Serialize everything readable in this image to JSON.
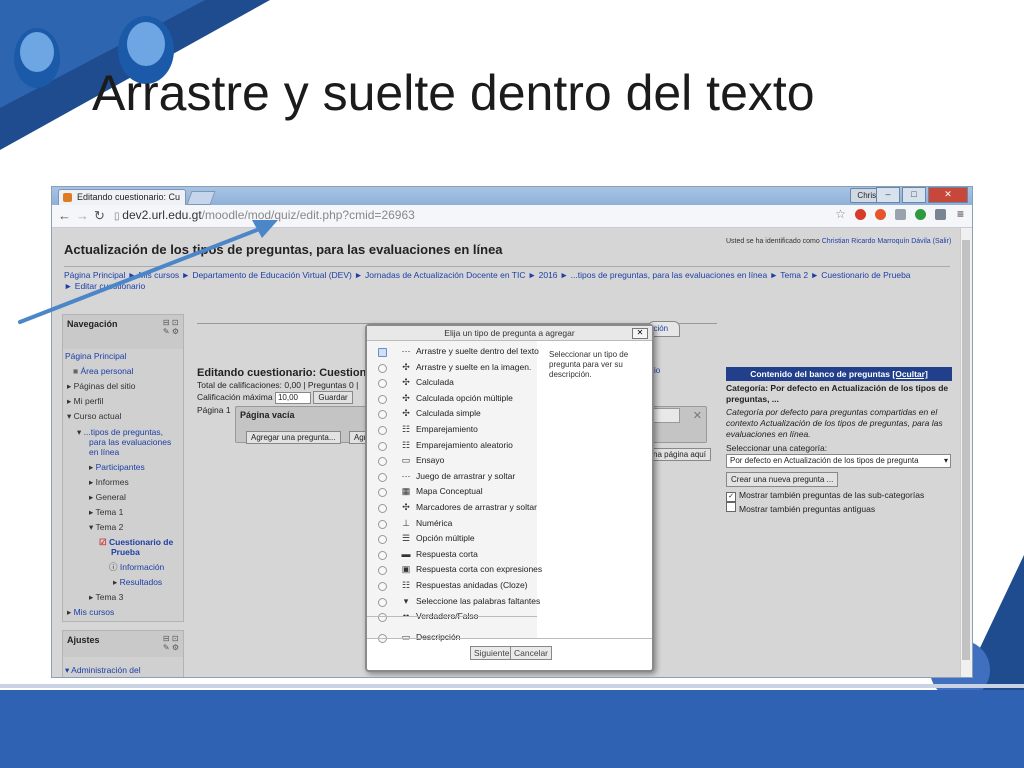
{
  "slide": {
    "title": "Arrastre y suelte dentro del texto"
  },
  "browser": {
    "tab_title": "Editando cuestionario: Cu",
    "user_label": "Christian",
    "url_host": "dev2.url.edu.gt",
    "url_path": "/moodle/mod/quiz/edit.php?cmid=26963"
  },
  "page": {
    "title": "Actualización de los tipos de preguntas, para las evaluaciones en línea",
    "logged_in_prefix": "Usted se ha identificado como",
    "logged_in_user": "Christian Ricardo Marroquín Dávila (Salir)",
    "breadcrumb_line1": "Página Principal ► Mis cursos ► Departamento de Educación Virtual (DEV) ► Jornadas de Actualización Docente en TIC ► 2016 ► ...tipos de preguntas, para las evaluaciones en línea ► Tema 2 ► Cuestionario de Prueba",
    "breadcrumb_line2": "► Editar cuestionario"
  },
  "navigation": {
    "heading": "Navegación",
    "items": [
      "Página Principal",
      "Área personal",
      "Páginas del sitio",
      "Mi perfil",
      "Curso actual",
      "...tipos de preguntas,",
      "para las evaluaciones",
      "en línea",
      "Participantes",
      "Informes",
      "General",
      "Tema 1",
      "Tema 2",
      "Cuestionario de",
      "Prueba",
      "Información",
      "Resultados",
      "Tema 3",
      "Mis cursos"
    ]
  },
  "settings": {
    "heading": "Ajustes",
    "item": "Administración del"
  },
  "quiz": {
    "heading": "Editando cuestionario: Cuestion",
    "total_line": "Total de calificaciones: 0,00 | Preguntas 0 |",
    "max_grade_label": "Calificación máxima",
    "max_grade_value": "10,00",
    "save_button": "Guardar",
    "page_label": "Página 1",
    "empty_page": "Página vacía",
    "add_question_button": "Agregar una pregunta...",
    "add_button_fragment": "Agr",
    "tab_fragment": "ación",
    "link_fragment": "io",
    "new_page_fragment": "na página aquí"
  },
  "bank": {
    "heading": "Contenido del banco de preguntas",
    "hide_link": "[Ocultar]",
    "category_line": "Categoría: Por defecto en Actualización de los tipos de preguntas, ...",
    "category_desc": "Categoría por defecto para preguntas compartidas en el contexto Actualización de los tipos de preguntas, para las evaluaciones en línea.",
    "select_label": "Seleccionar una categoría:",
    "select_value": "Por defecto en Actualización de los tipos de pregunta",
    "create_button": "Crear una nueva pregunta ...",
    "check_subcats": "Mostrar también preguntas de las sub-categorías",
    "check_old": "Mostrar también preguntas antiguas"
  },
  "modal": {
    "title": "Elija un tipo de pregunta a agregar",
    "close": "✕",
    "description": "Seleccionar un tipo de pregunta para ver su descripción.",
    "options": [
      {
        "label": "Arrastre y suelte dentro del texto",
        "icon": "⋯"
      },
      {
        "label": "Arrastre y suelte en la imagen.",
        "icon": "✣"
      },
      {
        "label": "Calculada",
        "icon": "✣"
      },
      {
        "label": "Calculada opción múltiple",
        "icon": "✣"
      },
      {
        "label": "Calculada simple",
        "icon": "✣"
      },
      {
        "label": "Emparejamiento",
        "icon": "☷"
      },
      {
        "label": "Emparejamiento aleatorio",
        "icon": "☷"
      },
      {
        "label": "Ensayo",
        "icon": "▭"
      },
      {
        "label": "Juego de arrastrar y soltar",
        "icon": "⋯"
      },
      {
        "label": "Mapa Conceptual",
        "icon": "▦"
      },
      {
        "label": "Marcadores de arrastrar y soltar",
        "icon": "✣"
      },
      {
        "label": "Numérica",
        "icon": "⊥"
      },
      {
        "label": "Opción múltiple",
        "icon": "☰"
      },
      {
        "label": "Respuesta corta",
        "icon": "▬"
      },
      {
        "label": "Respuesta corta con expresiones",
        "icon": "▣"
      },
      {
        "label": "Respuestas anidadas (Cloze)",
        "icon": "☷"
      },
      {
        "label": "Seleccione las palabras faltantes",
        "icon": "▾"
      },
      {
        "label": "Verdadero/Falso",
        "icon": "••"
      },
      {
        "label": "Descripción",
        "icon": "▭"
      }
    ],
    "next_button": "Siguiente",
    "cancel_button": "Cancelar"
  },
  "colors": {
    "accent": "#2f62b3",
    "arrow": "#4a86c8",
    "bank_header": "#223f8c"
  }
}
